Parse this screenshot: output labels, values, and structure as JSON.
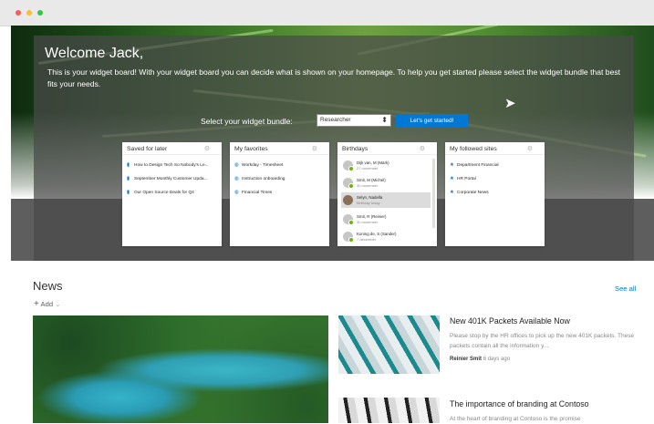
{
  "welcome": {
    "title": "Welcome Jack,",
    "intro": "This is your widget board! With your widget board you can decide what is shown on your homepage. To help you get started please select the widget bundle that best fits your needs.",
    "bundle_label": "Select your widget bundle:",
    "bundle_selected": "Researcher",
    "start_button": "Let's get started!"
  },
  "widgets": {
    "saved": {
      "title": "Saved for later",
      "items": [
        "How to Design Tech So Nobody's Le...",
        "September Monthly Customer Upda...",
        "Our Open Source Deals for Q4"
      ]
    },
    "favorites": {
      "title": "My favorites",
      "items": [
        "Workday - Timesheet",
        "Instruction onboarding",
        "Financial Times"
      ]
    },
    "birthdays": {
      "title": "Birthdays",
      "people": [
        {
          "name": "Dijk van, M (Mark)",
          "date": "27 november"
        },
        {
          "name": "Smit, M (Michel)",
          "date": "30 november"
        },
        {
          "name": "Selyn, Nadella",
          "date": "Birthday today"
        },
        {
          "name": "Smit, R (Reinier)",
          "date": "30 november"
        },
        {
          "name": "Koning de, S (Sander)",
          "date": "7 december"
        }
      ]
    },
    "sites": {
      "title": "My followed sites",
      "items": [
        "Department Financial",
        "HR Portal",
        "Corporate News"
      ]
    }
  },
  "news": {
    "title": "News",
    "add_label": "Add",
    "see_all": "See all",
    "articles": [
      {
        "title": "New 401K Packets Available Now",
        "text": "Please stop by the HR offices to pick up the new 401K packets. These packets contain all the information y...",
        "author": "Reinier Smit",
        "when": "6 days ago"
      },
      {
        "title": "The importance of branding at Contoso",
        "text": "At the heart of branding at Contoso is the promise"
      }
    ]
  },
  "icons": {
    "saved": "bookmark-icon",
    "favorites": "globe-icon",
    "sites": "star-icon",
    "settings": "gear-icon"
  },
  "colors": {
    "accent": "#0078d4"
  }
}
